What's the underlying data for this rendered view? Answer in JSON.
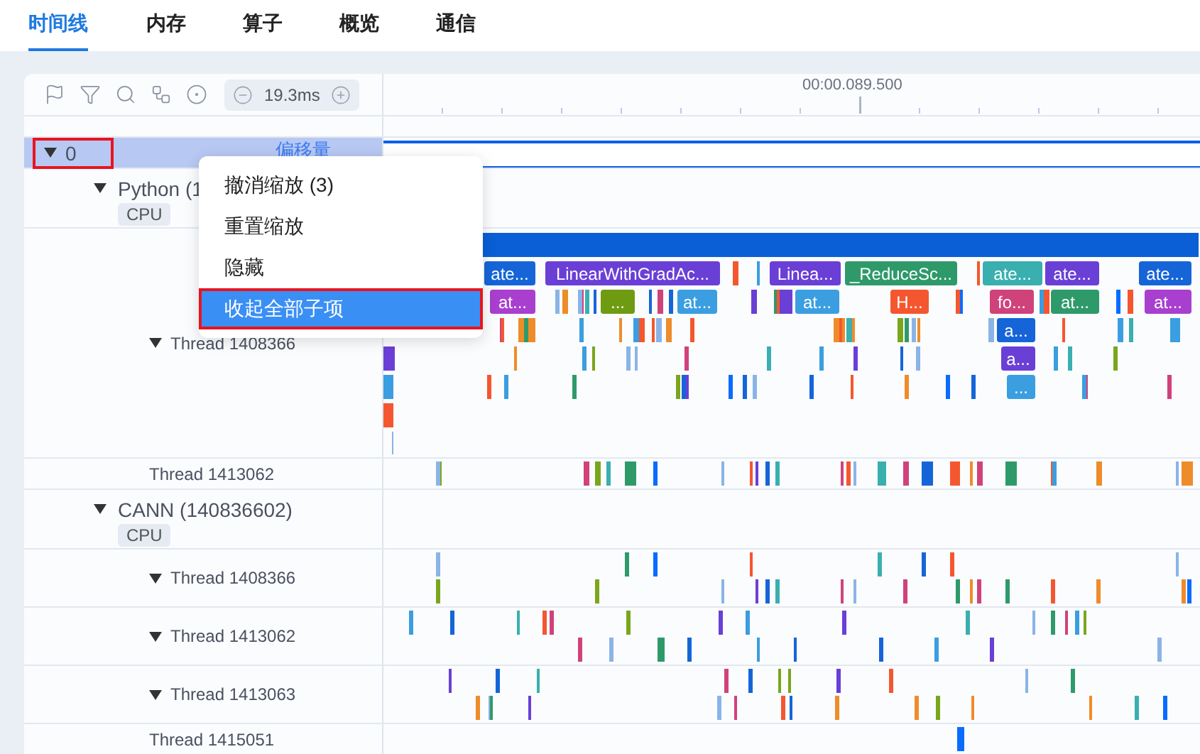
{
  "tabs": [
    {
      "label": "时间线",
      "selected": true
    },
    {
      "label": "内存",
      "selected": false
    },
    {
      "label": "算子",
      "selected": false
    },
    {
      "label": "概览",
      "selected": false
    },
    {
      "label": "通信",
      "selected": false
    }
  ],
  "toolbar": {
    "zoom_value": "19.3ms"
  },
  "ruler": {
    "label": "00:00.089.500"
  },
  "tree": [
    {
      "label": "0",
      "kind": "group",
      "expanded": true,
      "outlined": true,
      "caption": "偏移量",
      "children": [
        {
          "label": "Python (1",
          "kind": "process",
          "tag": "CPU",
          "expanded": true,
          "children": [
            {
              "label": "Thread 1408366",
              "kind": "flame",
              "expanded": true,
              "slices": [
                {
                  "label": "ate...",
                  "color": "#1565d8"
                },
                {
                  "label": "LinearWithGradAc...",
                  "color": "#6a3fd6"
                },
                {
                  "label": "Linea...",
                  "color": "#6a3fd6"
                },
                {
                  "label": "_ReduceSc...",
                  "color": "#2e9a6a"
                },
                {
                  "label": "ate...",
                  "color": "#3aafb0"
                },
                {
                  "label": "ate...",
                  "color": "#6a3fd6"
                },
                {
                  "label": "ate...",
                  "color": "#1565d8"
                },
                {
                  "label": "at...",
                  "color": "#a83fcf"
                },
                {
                  "label": "...",
                  "color": "#6f9b12"
                },
                {
                  "label": "at...",
                  "color": "#3a9ee0"
                },
                {
                  "label": "at...",
                  "color": "#3a9ee0"
                },
                {
                  "label": "H...",
                  "color": "#f4572f"
                },
                {
                  "label": "fo...",
                  "color": "#d0427a"
                },
                {
                  "label": "at...",
                  "color": "#2e9a6a"
                },
                {
                  "label": "at...",
                  "color": "#a83fcf"
                },
                {
                  "label": "a...",
                  "color": "#1565d8"
                },
                {
                  "label": "a...",
                  "color": "#6a3fd6"
                },
                {
                  "label": "...",
                  "color": "#3a9ee0"
                }
              ]
            },
            {
              "label": "Thread 1413062",
              "kind": "thread"
            }
          ]
        },
        {
          "label": "CANN (140836602)",
          "kind": "process",
          "tag": "CPU",
          "expanded": true,
          "children": [
            {
              "label": "Thread 1408366",
              "kind": "thread",
              "expanded": true
            },
            {
              "label": "Thread 1413062",
              "kind": "thread",
              "expanded": true
            },
            {
              "label": "Thread 1413063",
              "kind": "thread",
              "expanded": true
            },
            {
              "label": "Thread 1415051",
              "kind": "thread"
            }
          ]
        }
      ]
    }
  ],
  "context_menu": {
    "items": [
      {
        "label": "撤消缩放 (3)",
        "selected": false,
        "outlined": false
      },
      {
        "label": "重置缩放",
        "selected": false,
        "outlined": false
      },
      {
        "label": "隐藏",
        "selected": false,
        "outlined": false
      },
      {
        "label": "收起全部子项",
        "selected": true,
        "outlined": true
      }
    ]
  }
}
